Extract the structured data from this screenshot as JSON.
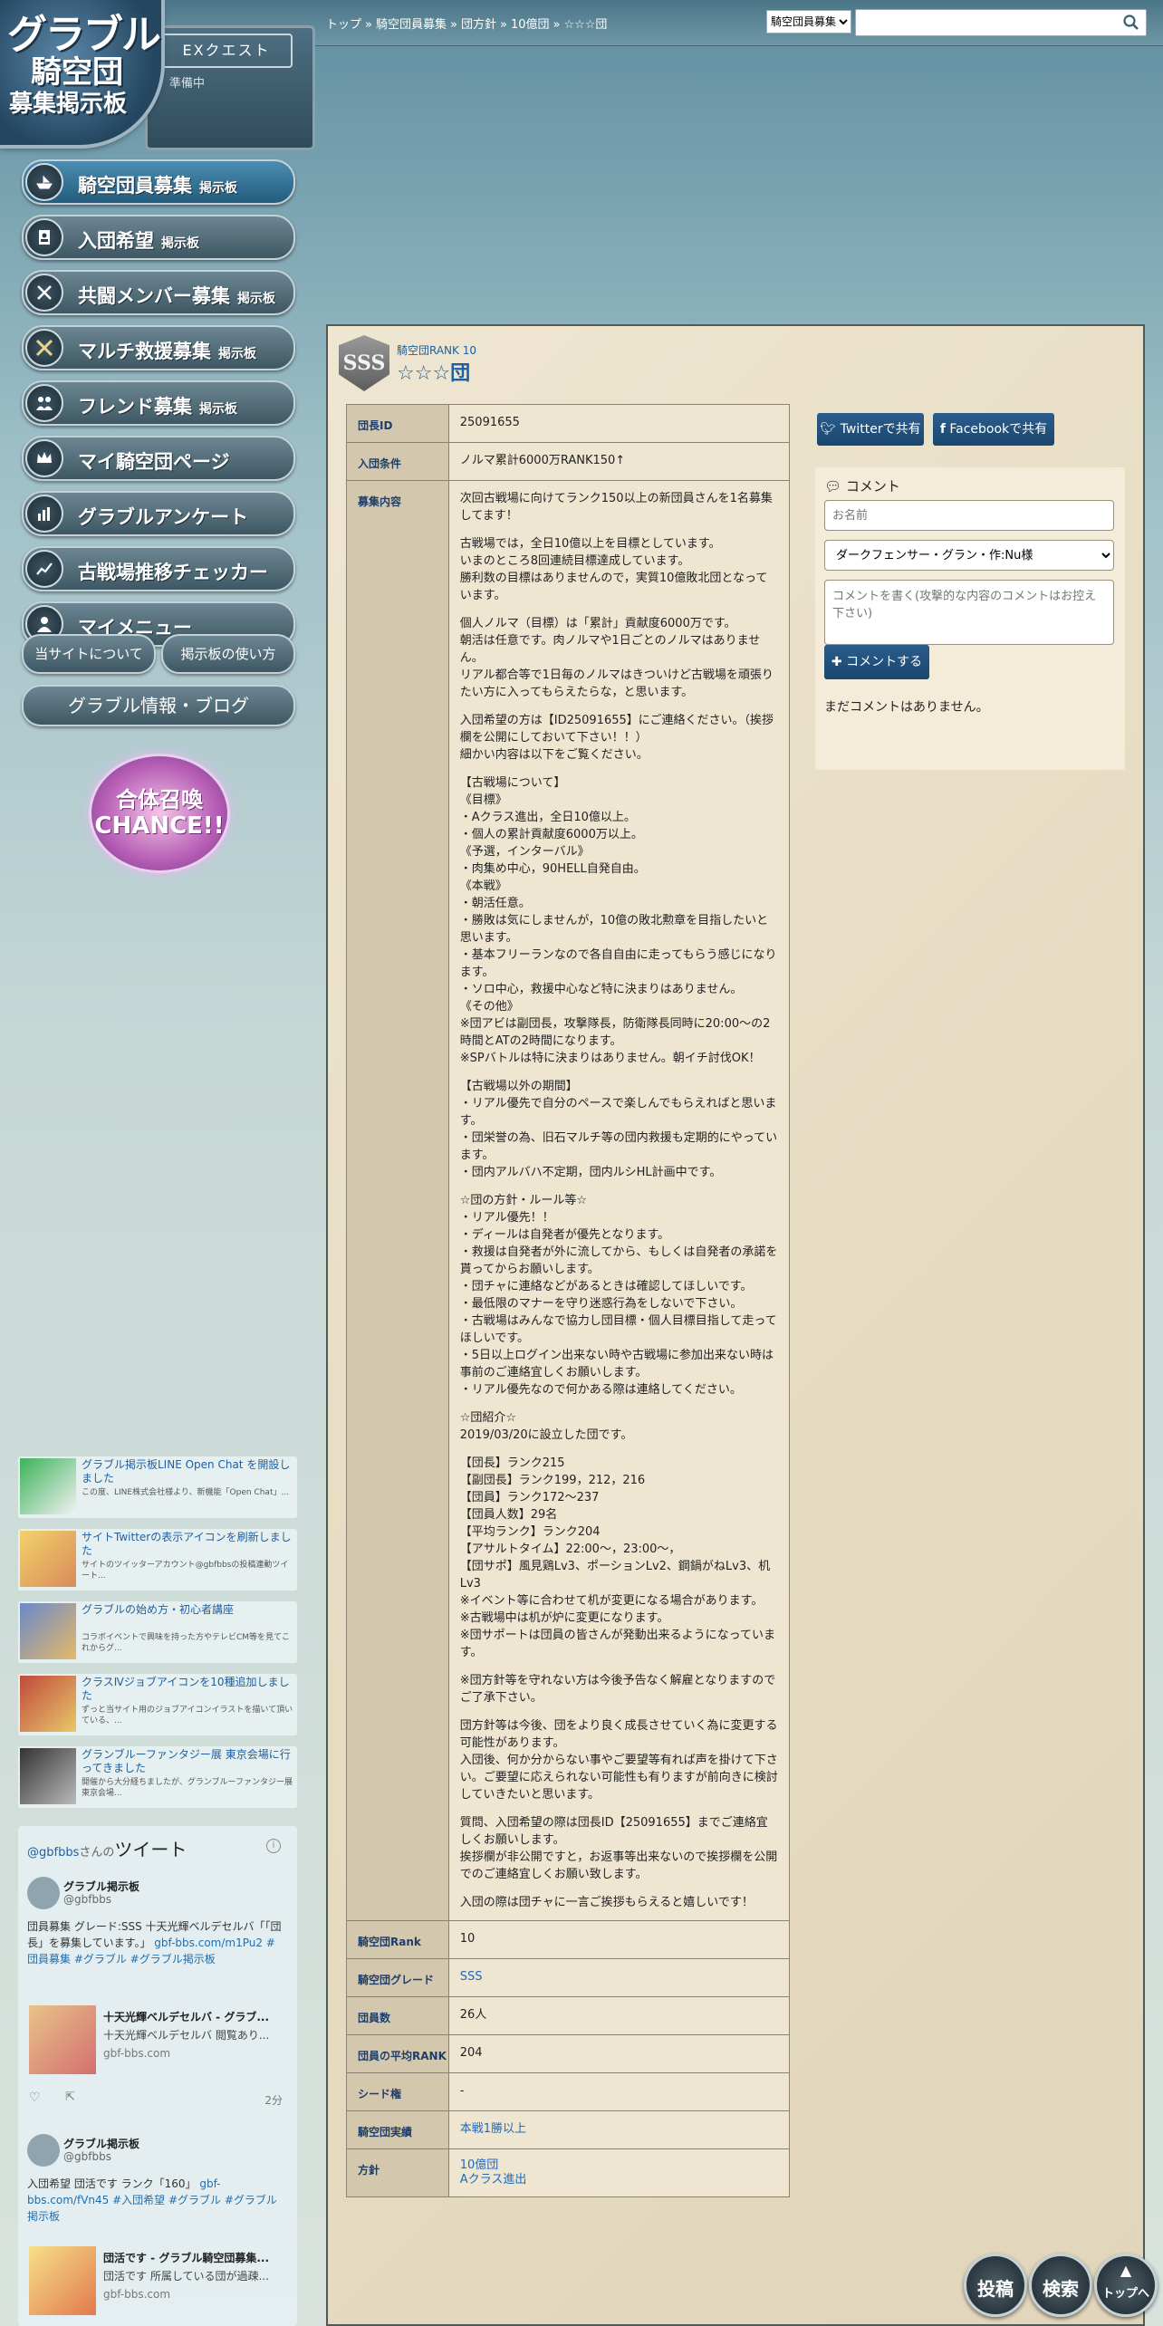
{
  "breadcrumb": [
    "トップ",
    "騎空団員募集",
    "団方針",
    "10億団",
    "☆☆☆団"
  ],
  "topbar": {
    "board_select": "騎空団員募集",
    "search_placeholder": ""
  },
  "logo": {
    "line1": "グラブル",
    "line2": "騎空団",
    "line3": "募集掲示板"
  },
  "exquest": {
    "label": "EXクエスト",
    "sub": "準備中"
  },
  "nav": [
    {
      "label": "騎空団員募集",
      "suffix": "掲示板",
      "icon": "ship-icon"
    },
    {
      "label": "入団希望",
      "suffix": "掲示板",
      "icon": "person-card-icon"
    },
    {
      "label": "共闘メンバー募集",
      "suffix": "掲示板",
      "icon": "swords-icon"
    },
    {
      "label": "マルチ救援募集",
      "suffix": "掲示板",
      "icon": "crossed-blades-icon"
    },
    {
      "label": "フレンド募集",
      "suffix": "掲示板",
      "icon": "friends-icon"
    },
    {
      "label": "マイ騎空団ページ",
      "suffix": "",
      "icon": "crown-icon"
    },
    {
      "label": "グラブルアンケート",
      "suffix": "",
      "icon": "bar-chart-icon"
    },
    {
      "label": "古戦場推移チェッカー",
      "suffix": "",
      "icon": "line-chart-icon"
    },
    {
      "label": "マイメニュー",
      "suffix": "",
      "icon": "user-icon"
    }
  ],
  "pills": {
    "about": "当サイトについて",
    "howto": "掲示板の使い方"
  },
  "blog": "グラブル情報・ブログ",
  "gattai": {
    "line1": "合体召喚",
    "line2": "CHANCE!!"
  },
  "news": [
    {
      "title": "グラブル掲示板LINE Open Chat を開設しました",
      "desc": "この度、LINE株式会社様より、新機能「Open Chat」..."
    },
    {
      "title": "サイトTwitterの表示アイコンを刷新しました",
      "desc": "サイトのツイッターアカウント@gbfbbsの投稿連動ツイート..."
    },
    {
      "title": "グラブルの始め方・初心者講座",
      "desc": "コラボイベントで興味を持った方やテレビCM等を見てこれからグ..."
    },
    {
      "title": "クラスⅣジョブアイコンを10種追加しました",
      "desc": "ずっと当サイト用のジョブアイコンイラストを描いて頂いている、..."
    },
    {
      "title": "グランブルーファンタジー展 東京会場に行ってきました",
      "desc": "開催から大分経ちましたが、グランブルーファンタジー展東京会場..."
    }
  ],
  "twitter": {
    "account": "@gbfbbs",
    "account_suffix": "さんの",
    "heading": "ツイート",
    "tweets": [
      {
        "name": "グラブル掲示板",
        "handle": "@gbfbbs",
        "text": "団員募集 グレード:SSS 十天光輝ベルデセルバ「「団長」を募集しています。」",
        "links": "gbf-bbs.com/m1Pu2 #団員募集 #グラブル #グラブル掲示板",
        "card_title": "十天光輝ベルデセルバ - グラブ...",
        "card_desc": "十天光輝ベルデセルバ 閲覧あり...",
        "card_url": "gbf-bbs.com",
        "time": "2分"
      },
      {
        "name": "グラブル掲示板",
        "handle": "@gbfbbs",
        "text": "入団希望 団活です ランク「160」",
        "links": "gbf-bbs.com/fVn45 #入団希望 #グラブル #グラブル掲示板",
        "card_title": "団活です - グラブル騎空団募集...",
        "card_desc": "団活です 所属している団が過疎...",
        "card_url": "gbf-bbs.com"
      }
    ]
  },
  "group": {
    "rank_label": "騎空団RANK 10",
    "name": "☆☆☆団",
    "badge": "SSS"
  },
  "table": {
    "leader_id_label": "団長ID",
    "leader_id": "25091655",
    "condition_label": "入団条件",
    "condition": "ノルマ累計6000万RANK150↑",
    "content_label": "募集内容",
    "content": [
      "次回古戦場に向けてランク150以上の新団員さんを1名募集してます！",
      "古戦場では，全日10億以上を目標としています。\nいまのところ8回連続目標達成しています。\n勝利数の目標はありませんので，実質10億敗北団となっています。",
      "個人ノルマ（目標）は「累計」貢献度6000万です。\n朝活は任意です。肉ノルマや1日ごとのノルマはありません。\nリアル都合等で1日毎のノルマはきついけど古戦場を頑張りたい方に入ってもらえたらな，と思います。",
      "入団希望の方は【ID25091655】にご連絡ください。（挨拶欄を公開にしておいて下さい！！）\n細かい内容は以下をご覧ください。",
      "【古戦場について】\n《目標》\n・Aクラス進出，全日10億以上。\n・個人の累計貢献度6000万以上。\n《予選，インターバル》\n・肉集め中心，90HELL自発自由。\n《本戦》\n・朝活任意。\n・勝敗は気にしませんが，10億の敗北勲章を目指したいと思います。\n・基本フリーランなので各自自由に走ってもらう感じになります。\n・ソロ中心，救援中心など特に決まりはありません。\n《その他》\n※団アビは副団長，攻撃隊長，防衛隊長同時に20:00～の2時間とATの2時間になります。\n※SPバトルは特に決まりはありません。朝イチ討伐OK！",
      "【古戦場以外の期間】\n・リアル優先で自分のペースで楽しんでもらえればと思います。\n・団栄誉の為、旧石マルチ等の団内救援も定期的にやっています。\n・団内アルバハ不定期，団内ルシHL計画中です。",
      "☆団の方針・ルール等☆\n・リアル優先！！\n・ディールは自発者が優先となります。\n・救援は自発者が外に流してから、もしくは自発者の承諾を貰ってからお願いします。\n・団チャに連絡などがあるときは確認してほしいです。\n・最低限のマナーを守り迷惑行為をしないで下さい。\n・古戦場はみんなで協力し団目標・個人目標目指して走ってほしいです。\n・5日以上ログイン出来ない時や古戦場に参加出来ない時は事前のご連絡宜しくお願いします。\n・リアル優先なので何かある際は連絡してください。",
      "☆団紹介☆\n2019/03/20に設立した団です。",
      "【団長】ランク215\n【副団長】ランク199，212，216\n【団員】ランク172～237\n【団員人数】29名\n【平均ランク】ランク204\n【アサルトタイム】22:00～，23:00～，\n【団サポ】風見鶏Lv3、ポーションLv2、鋼鍋がねLv3、机Lv3\n※イベント等に合わせて机が変更になる場合があります。\n※古戦場中は机が炉に変更になります。\n※団サポートは団員の皆さんが発動出来るようになっています。",
      "※団方針等を守れない方は今後予告なく解雇となりますのでご了承下さい。",
      "団方針等は今後、団をより良く成長させていく為に変更する可能性があります。\n入団後、何か分からない事やご要望等有れば声を掛けて下さい。ご要望に応えられない可能性も有りますが前向きに検討していきたいと思います。",
      "質問、入団希望の際は団長ID【25091655】までご連絡宜しくお願いします。\n挨拶欄が非公開ですと，お返事等出来ないので挨拶欄を公開でのご連絡宜しくお願い致します。",
      "入団の際は団チャに一言ご挨拶もらえると嬉しいです！"
    ],
    "rank_label": "騎空団Rank",
    "rank": "10",
    "grade_label": "騎空団グレード",
    "grade": "SSS",
    "members_label": "団員数",
    "members": "26人",
    "avg_rank_label": "団員の平均RANK",
    "avg_rank": "204",
    "seed_label": "シード権",
    "seed": "-",
    "achievement_label": "騎空団実績",
    "achievement": "本戦1勝以上",
    "policy_label": "方針",
    "policy1": "10億団",
    "policy2": "Aクラス進出"
  },
  "share": {
    "twitter": "Twitterで共有",
    "facebook": "Facebookで共有"
  },
  "comment": {
    "title": "コメント",
    "name_placeholder": "お名前",
    "char_select": "ダークフェンサー・グラン・作:Nu様",
    "body_placeholder": "コメントを書く(攻撃的な内容のコメントはお控え下さい)",
    "submit": "コメントする",
    "empty": "まだコメントはありません。"
  },
  "fab": {
    "post": "投稿",
    "search": "検索",
    "top": "トップへ"
  },
  "colors": {
    "accent": "#1e5fa0",
    "panel": "#efe6d2",
    "label_bg": "#d3c8ae"
  }
}
